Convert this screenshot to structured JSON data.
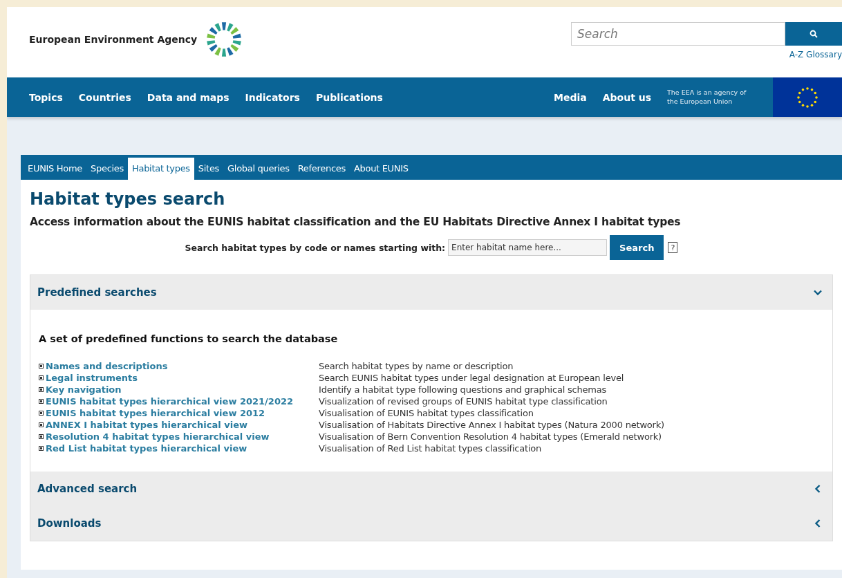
{
  "header": {
    "agency_name": "European Environment Agency",
    "search": {
      "placeholder": "Search"
    },
    "glossary_link": "A-Z Glossary"
  },
  "main_nav": {
    "left": [
      "Topics",
      "Countries",
      "Data and maps",
      "Indicators",
      "Publications"
    ],
    "right": [
      "Media",
      "About us"
    ],
    "eu_note": "The EEA is an agency of the European Union"
  },
  "tabs": [
    {
      "label": "EUNIS Home",
      "selected": false
    },
    {
      "label": "Species",
      "selected": false
    },
    {
      "label": "Habitat types",
      "selected": true
    },
    {
      "label": "Sites",
      "selected": false
    },
    {
      "label": "Global queries",
      "selected": false
    },
    {
      "label": "References",
      "selected": false
    },
    {
      "label": "About EUNIS",
      "selected": false
    }
  ],
  "page": {
    "title": "Habitat types search",
    "subtitle": "Access information about the EUNIS habitat classification and the EU Habitats Directive Annex I habitat types",
    "search_label": "Search habitat types by code or names starting with:",
    "search_field": {
      "placeholder": "Enter habitat name here..."
    },
    "search_button": "Search",
    "help_icon": "?"
  },
  "sections": [
    {
      "title": "Predefined searches",
      "expanded": true,
      "heading": "A set of predefined functions to search the database",
      "items": [
        {
          "link": "Names and descriptions",
          "description": "Search habitat types by name or description"
        },
        {
          "link": "Legal instruments",
          "description": "Search EUNIS habitat types under legal designation at European level"
        },
        {
          "link": "Key navigation",
          "description": "Identify a habitat type following questions and graphical schemas"
        },
        {
          "link": "EUNIS habitat types hierarchical view 2021/2022",
          "description": "Visualization of revised groups of EUNIS habitat type classification"
        },
        {
          "link": "EUNIS habitat types hierarchical view 2012",
          "description": "Visualisation of EUNIS habitat types classification"
        },
        {
          "link": "ANNEX I habitat types hierarchical view",
          "description": "Visualisation of Habitats Directive Annex I habitat types (Natura 2000 network)"
        },
        {
          "link": "Resolution 4 habitat types hierarchical view",
          "description": "Visualisation of Bern Convention Resolution 4 habitat types (Emerald network)"
        },
        {
          "link": "Red List habitat types hierarchical view",
          "description": "Visualisation of Red List habitat types classification"
        }
      ]
    },
    {
      "title": "Advanced search",
      "expanded": false
    },
    {
      "title": "Downloads",
      "expanded": false
    }
  ]
}
